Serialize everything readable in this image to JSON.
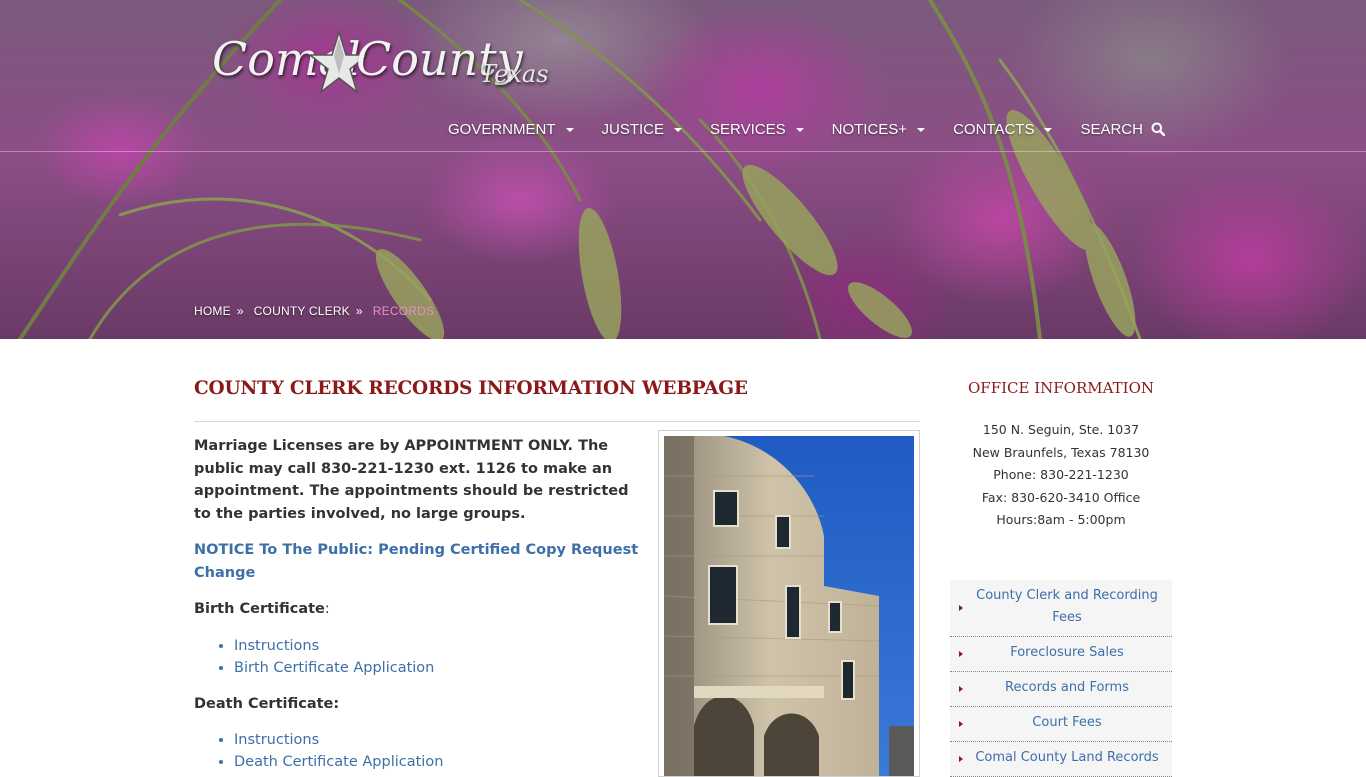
{
  "header": {
    "logo": {
      "word1": "Comal",
      "word2": "County",
      "word3": "Texas"
    },
    "nav": [
      {
        "label": "GOVERNMENT",
        "has_dropdown": true
      },
      {
        "label": "JUSTICE",
        "has_dropdown": true
      },
      {
        "label": "SERVICES",
        "has_dropdown": true
      },
      {
        "label": "NOTICES+",
        "has_dropdown": true
      },
      {
        "label": "CONTACTS",
        "has_dropdown": true
      },
      {
        "label": "SEARCH",
        "icon": "search-icon"
      }
    ],
    "breadcrumb": [
      {
        "label": "HOME"
      },
      {
        "label": "COUNTY CLERK"
      },
      {
        "label": "RECORDS",
        "current": true
      }
    ]
  },
  "main": {
    "title": "COUNTY CLERK RECORDS INFORMATION WEBPAGE",
    "intro": "Marriage Licenses are by APPOINTMENT ONLY. The public may call 830-221-1230 ext. 1126 to make an appointment. The appointments should be restricted to the parties involved, no large groups.",
    "notice_link": "NOTICE To The Public: Pending Certified Copy Request Change",
    "sections": [
      {
        "heading": "Birth Certificate",
        "suffix": ":",
        "links": [
          "Instructions",
          "Birth Certificate Application"
        ]
      },
      {
        "heading": "Death Certificate:",
        "suffix": "",
        "links": [
          "Instructions",
          "Death Certificate Application"
        ]
      }
    ]
  },
  "sidebar": {
    "office_title": "OFFICE INFORMATION",
    "office_lines": [
      "150 N. Seguin, Ste. 1037",
      "New Braunfels, Texas 78130",
      "Phone: 830-221-1230",
      "Fax: 830-620-3410 Office",
      "Hours:8am - 5:00pm"
    ],
    "menu": [
      "County Clerk and Recording Fees",
      "Foreclosure Sales",
      "Records and Forms",
      "Court Fees",
      "Comal County Land Records"
    ]
  },
  "colors": {
    "title_red": "#8a1a1a",
    "link_blue": "#3d6fa8",
    "breadcrumb_current": "#e88fc6",
    "sidebar_menu_bg": "#f5f5f5"
  }
}
